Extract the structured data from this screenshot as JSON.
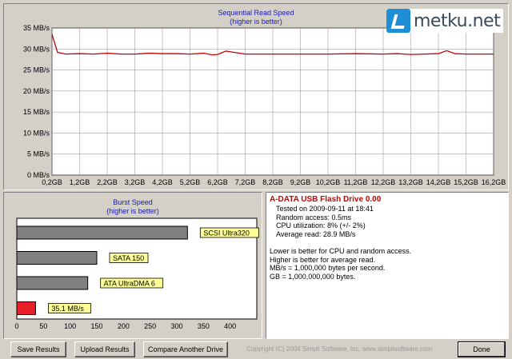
{
  "read_chart": {
    "title": "Sequential Read Speed",
    "subtitle": "(higher is better)",
    "y_ticks": [
      "35 MB/s",
      "30 MB/s",
      "25 MB/s",
      "20 MB/s",
      "15 MB/s",
      "10 MB/s",
      "5 MB/s",
      "0 MB/s"
    ],
    "x_ticks": [
      "0,2GB",
      "1,2GB",
      "2,2GB",
      "3,2GB",
      "4,2GB",
      "5,2GB",
      "6,2GB",
      "7,2GB",
      "8,2GB",
      "9,2GB",
      "10,2GB",
      "11,2GB",
      "12,2GB",
      "13,2GB",
      "14,2GB",
      "15,2GB",
      "16,2GB"
    ],
    "line_color": "#c00000"
  },
  "burst_chart": {
    "title": "Burst Speed",
    "subtitle": "(higher is better)",
    "x_ticks": [
      "0",
      "50",
      "100",
      "150",
      "200",
      "250",
      "300",
      "350",
      "400"
    ],
    "bars": [
      {
        "label": "SCSI Ultra320",
        "value": 320,
        "color": "#808080"
      },
      {
        "label": "SATA 150",
        "value": 150,
        "color": "#808080"
      },
      {
        "label": "ATA UltraDMA 6",
        "value": 133,
        "color": "#808080"
      },
      {
        "label": "35.1 MB/s",
        "value": 35.1,
        "color": "#e8202a"
      }
    ]
  },
  "chart_data": [
    {
      "type": "line",
      "title": "Sequential Read Speed",
      "subtitle": "(higher is better)",
      "xlabel": "",
      "ylabel": "",
      "ylim": [
        0,
        35
      ],
      "x": [
        0.2,
        0.4,
        0.7,
        1.2,
        1.7,
        2.2,
        2.7,
        3.2,
        3.7,
        4.2,
        4.7,
        5.2,
        5.7,
        6.0,
        6.2,
        6.5,
        7.2,
        8.2,
        9.2,
        10.2,
        11.2,
        12.2,
        12.7,
        13.2,
        13.7,
        14.2,
        14.5,
        14.8,
        15.2,
        15.7,
        16.2
      ],
      "series": [
        {
          "values": [
            33.5,
            29.2,
            28.8,
            28.9,
            28.8,
            29.0,
            28.8,
            28.8,
            29.0,
            28.9,
            28.9,
            28.8,
            29.0,
            28.6,
            28.7,
            29.5,
            28.8,
            28.8,
            28.8,
            28.8,
            28.9,
            28.8,
            28.9,
            28.7,
            28.8,
            28.9,
            29.6,
            28.9,
            28.8,
            28.8,
            28.8
          ]
        }
      ]
    },
    {
      "type": "bar",
      "title": "Burst Speed",
      "subtitle": "(higher is better)",
      "categories": [
        "SCSI Ultra320",
        "SATA 150",
        "ATA UltraDMA 6",
        "35.1 MB/s"
      ],
      "values": [
        320,
        150,
        133,
        35.1
      ],
      "xlim": [
        0,
        450
      ]
    }
  ],
  "info": {
    "title": "A-DATA USB Flash Drive 0.00",
    "lines": [
      "Tested on 2009-09-11 at 18:41",
      "Random access: 0.5ms",
      "CPU utilization: 8% (+/- 2%)",
      "Average read: 28.9 MB/s"
    ],
    "notes": [
      "Lower is better for CPU and random access.",
      "Higher is better for average read.",
      "MB/s = 1,000,000 bytes per second.",
      "GB = 1,000,000,000 bytes."
    ]
  },
  "buttons": {
    "save": "Save Results",
    "upload": "Upload Results",
    "compare": "Compare Another Drive",
    "done": "Done"
  },
  "copyright": "Copyright (C) 2004 Simpli Software, Inc. www.simplisoftware.com",
  "logo": {
    "text": "metku.net",
    "accent": "#1e8fd6"
  }
}
